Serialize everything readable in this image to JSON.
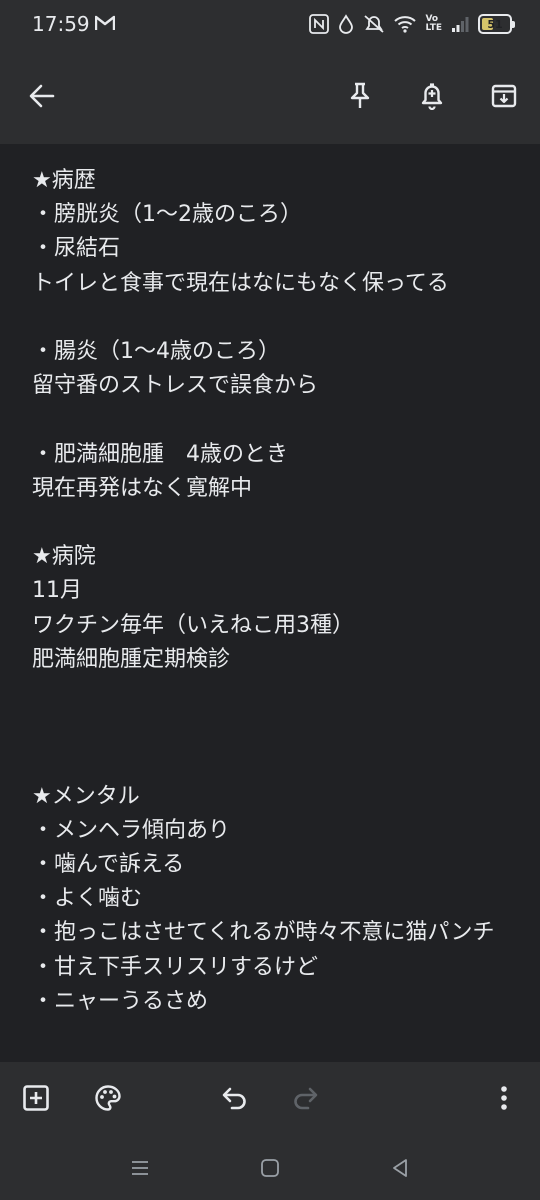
{
  "status_bar": {
    "time": "17:59",
    "battery": "51",
    "battery_level": 0.51,
    "icons": [
      "gmail-icon",
      "nfc-icon",
      "data-saver-icon",
      "mute-icon",
      "wifi-icon",
      "volte-icon",
      "signal-icon",
      "battery-icon"
    ],
    "volte_label": "Vo\nLTE"
  },
  "app_bar": {
    "icons": [
      "back-arrow-icon",
      "pin-icon",
      "reminder-bell-icon",
      "archive-icon"
    ]
  },
  "note": {
    "body": "★病歴\n・膀胱炎（1〜2歳のころ）\n・尿結石\nトイレと食事で現在はなにもなく保ってる\n\n・腸炎（1〜4歳のころ）\n留守番のストレスで誤食から\n\n・肥満細胞腫　4歳のとき\n現在再発はなく寛解中\n\n★病院\n11月\nワクチン毎年（いえねこ用3種）\n肥満細胞腫定期検診\n\n\n\n★メンタル\n・メンヘラ傾向あり\n・噛んで訴える\n・よく噛む\n・抱っこはさせてくれるが時々不意に猫パンチ\n・甘え下手スリスリするけど\n・ニャーうるさめ"
  },
  "bottom_bar": {
    "icons": [
      "add-box-icon",
      "palette-icon",
      "undo-icon",
      "redo-icon",
      "more-vert-icon"
    ]
  },
  "nav_bar": {
    "icons": [
      "recent-apps-icon",
      "home-icon",
      "back-icon"
    ]
  },
  "colors": {
    "background": "#202124",
    "bar": "#2d2e30",
    "text": "#e8eaed",
    "disabled": "#5f6368",
    "battery_fill": "#d6c46a"
  }
}
